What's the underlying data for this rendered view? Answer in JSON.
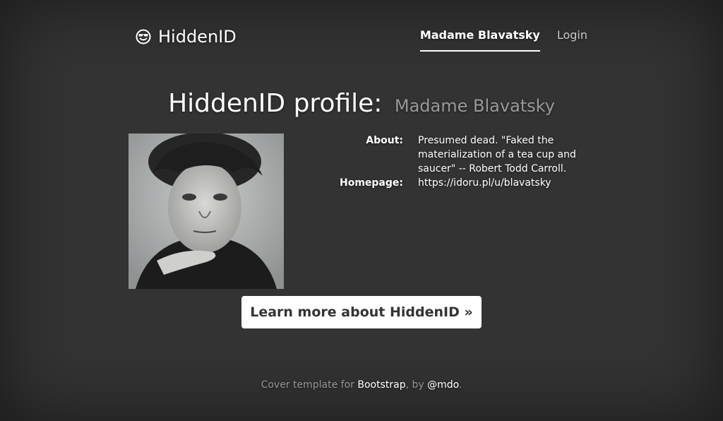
{
  "brand": {
    "name": "HiddenID",
    "icon": "smiley-sunglasses-icon"
  },
  "nav": {
    "items": [
      {
        "label": "Madame Blavatsky",
        "active": true
      },
      {
        "label": "Login",
        "active": false
      }
    ]
  },
  "profile": {
    "heading": "HiddenID profile:",
    "name": "Madame Blavatsky",
    "about_label": "About:",
    "about": "Presumed dead. \"Faked the materialization of a tea cup and saucer\" -- Robert Todd Carroll.",
    "homepage_label": "Homepage:",
    "homepage": "https://idoru.pl/u/blavatsky"
  },
  "cta": {
    "label": "Learn more about HiddenID »"
  },
  "footer": {
    "prefix": "Cover template for ",
    "link1": "Bootstrap",
    "middle": ", by ",
    "link2": "@mdo",
    "suffix": "."
  }
}
